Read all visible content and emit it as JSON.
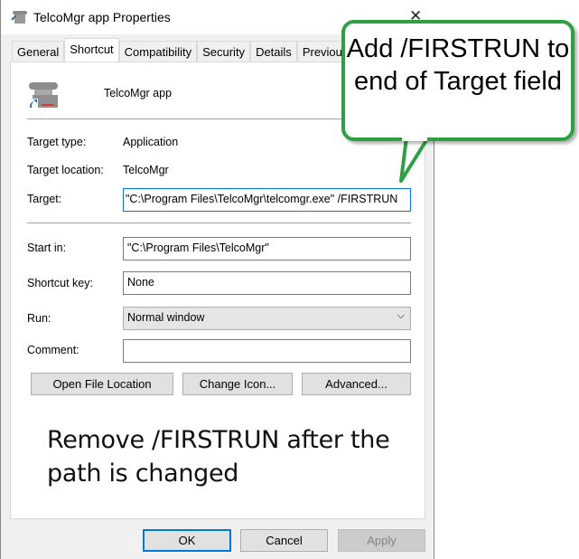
{
  "window": {
    "title": "TelcoMgr app Properties",
    "close_icon": "close-icon"
  },
  "tabs": [
    {
      "label": "General"
    },
    {
      "label": "Shortcut",
      "active": true
    },
    {
      "label": "Compatibility"
    },
    {
      "label": "Security"
    },
    {
      "label": "Details"
    },
    {
      "label": "Previous Versions"
    }
  ],
  "shortcut": {
    "app_name": "TelcoMgr app",
    "target_type_label": "Target type:",
    "target_type": "Application",
    "target_location_label": "Target location:",
    "target_location": "TelcoMgr",
    "target_label": "Target:",
    "target": "\"C:\\Program Files\\TelcoMgr\\telcomgr.exe\" /FIRSTRUN",
    "start_in_label": "Start in:",
    "start_in": "\"C:\\Program Files\\TelcoMgr\"",
    "shortcut_key_label": "Shortcut key:",
    "shortcut_key": "None",
    "run_label": "Run:",
    "run": "Normal window",
    "comment_label": "Comment:",
    "comment": "",
    "open_file_location": "Open File Location",
    "change_icon": "Change Icon...",
    "advanced": "Advanced..."
  },
  "footer": {
    "ok": "OK",
    "cancel": "Cancel",
    "apply": "Apply"
  },
  "annotations": {
    "callout": "Add /FIRSTRUN to end of Target field",
    "note": "Remove /FIRSTRUN after the path is changed",
    "callout_color": "#2ea043"
  }
}
